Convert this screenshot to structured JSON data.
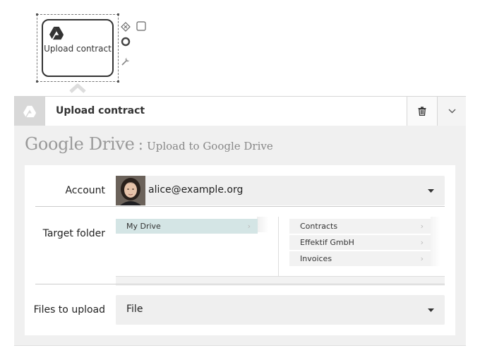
{
  "canvas": {
    "task": {
      "label": "Upload contract",
      "icon": "google-drive-icon"
    },
    "context_tools": [
      "gateway-icon",
      "task-icon",
      "end-event-icon",
      "wrench-icon"
    ]
  },
  "panel": {
    "header": {
      "icon": "google-drive-icon",
      "name": "Upload contract",
      "delete_icon": "trash-icon",
      "toggle_icon": "chevron-down-icon"
    },
    "title": {
      "service": "Google Drive",
      "separator": ":",
      "action": "Upload to Google Drive"
    },
    "form": {
      "account": {
        "label": "Account",
        "value": "alice@example.org"
      },
      "target_folder": {
        "label": "Target folder",
        "column1": [
          {
            "name": "My Drive",
            "selected": true
          }
        ],
        "column2": [
          {
            "name": "Contracts"
          },
          {
            "name": "Effektif GmbH"
          },
          {
            "name": "Invoices"
          }
        ]
      },
      "files": {
        "label": "Files to upload",
        "value": "File"
      }
    }
  },
  "colors": {
    "selected_folder": "#d4e5e5",
    "panel_bg": "#f0f0f0",
    "field_bg": "#efefef"
  }
}
